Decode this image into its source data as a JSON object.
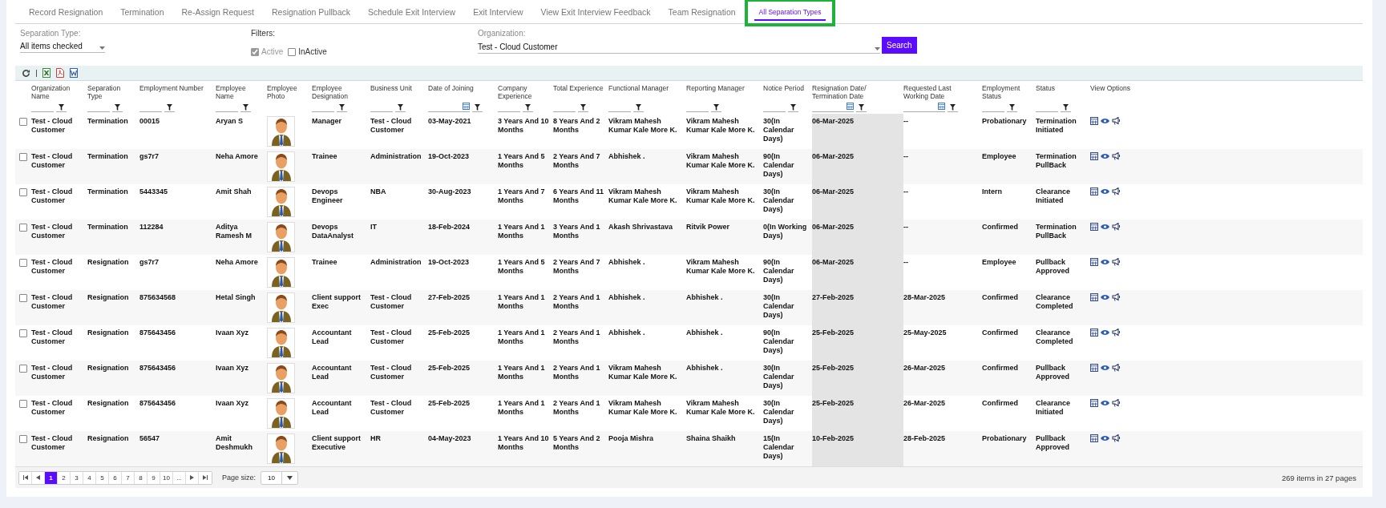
{
  "tabs": [
    {
      "label": "Record Resignation",
      "selected": false,
      "highlighted": false
    },
    {
      "label": "Termination",
      "selected": false,
      "highlighted": false
    },
    {
      "label": "Re-Assign Request",
      "selected": false,
      "highlighted": false
    },
    {
      "label": "Resignation Pullback",
      "selected": false,
      "highlighted": false
    },
    {
      "label": "Schedule Exit Interview",
      "selected": false,
      "highlighted": false
    },
    {
      "label": "Exit Interview",
      "selected": false,
      "highlighted": false
    },
    {
      "label": "View Exit Interview Feedback",
      "selected": false,
      "highlighted": false
    },
    {
      "label": "Team Resignation",
      "selected": false,
      "highlighted": false
    },
    {
      "label": "All Separation Types",
      "selected": true,
      "highlighted": true
    }
  ],
  "filters": {
    "separation_type": {
      "label": "Separation Type:",
      "value": "All items checked"
    },
    "status_filters": {
      "label": "Filters:",
      "options": [
        {
          "label": "Active",
          "checked": true,
          "disabled": true
        },
        {
          "label": "InActive",
          "checked": false,
          "disabled": false
        }
      ]
    },
    "organization": {
      "label": "Organization:",
      "value": "Test - Cloud Customer"
    },
    "search_button": "Search"
  },
  "table": {
    "columns": [
      {
        "label": "Organization Name",
        "kind": "text",
        "filterable": true,
        "date_picker": false,
        "shaded": false
      },
      {
        "label": "Separation Type",
        "kind": "text",
        "filterable": true,
        "date_picker": false,
        "shaded": false
      },
      {
        "label": "Employment Number",
        "kind": "text",
        "filterable": true,
        "date_picker": false,
        "shaded": false
      },
      {
        "label": "Employee Name",
        "kind": "text",
        "filterable": true,
        "date_picker": false,
        "shaded": false
      },
      {
        "label": "Employee Photo",
        "kind": "photo",
        "filterable": false,
        "shaded": false
      },
      {
        "label": "Employee Designation",
        "kind": "text",
        "filterable": true,
        "date_picker": false,
        "shaded": false
      },
      {
        "label": "Business Unit",
        "kind": "text",
        "filterable": true,
        "date_picker": false,
        "shaded": false
      },
      {
        "label": "Date of Joining",
        "kind": "text",
        "filterable": true,
        "date_picker": true,
        "shaded": false
      },
      {
        "label": "Company Experience",
        "kind": "text",
        "filterable": true,
        "date_picker": false,
        "shaded": false
      },
      {
        "label": "Total Experience",
        "kind": "text",
        "filterable": true,
        "date_picker": false,
        "shaded": false
      },
      {
        "label": "Functional Manager",
        "kind": "text",
        "filterable": true,
        "date_picker": false,
        "shaded": false
      },
      {
        "label": "Reporting Manager",
        "kind": "text",
        "filterable": true,
        "date_picker": false,
        "shaded": false
      },
      {
        "label": "Notice Period",
        "kind": "text",
        "filterable": true,
        "date_picker": false,
        "shaded": false
      },
      {
        "label": "Resignation Date/ Termination Date",
        "kind": "text",
        "filterable": true,
        "date_picker": true,
        "shaded": true
      },
      {
        "label": "Requested Last Working Date",
        "kind": "text",
        "filterable": true,
        "date_picker": true,
        "shaded": false
      },
      {
        "label": "Employment Status",
        "kind": "text",
        "filterable": true,
        "date_picker": false,
        "shaded": false
      },
      {
        "label": "Status",
        "kind": "text",
        "filterable": true,
        "date_picker": false,
        "shaded": false
      },
      {
        "label": "View Options",
        "kind": "actions",
        "filterable": false,
        "shaded": false
      }
    ],
    "rows": [
      {
        "checked": false,
        "cells": [
          "Test - Cloud Customer",
          "Termination",
          "00015",
          "Aryan S",
          "",
          "Manager",
          "Test - Cloud Customer",
          "03-May-2021",
          "3 Years And 10 Months",
          "8 Years And 2 Months",
          "Vikram Mahesh Kumar Kale More K.",
          "Vikram Mahesh Kumar Kale More K.",
          "30(In Calendar Days)",
          "06-Mar-2025",
          "--",
          "Probationary",
          "Termination Initiated",
          ""
        ]
      },
      {
        "checked": false,
        "cells": [
          "Test - Cloud Customer",
          "Termination",
          "gs7r7",
          "Neha Amore",
          "",
          "Trainee",
          "Administration",
          "19-Oct-2023",
          "1 Years And 5 Months",
          "2 Years And 7 Months",
          "Abhishek .",
          "Vikram Mahesh Kumar Kale More K.",
          "90(In Calendar Days)",
          "06-Mar-2025",
          "--",
          "Employee",
          "Termination PullBack",
          ""
        ]
      },
      {
        "checked": false,
        "cells": [
          "Test - Cloud Customer",
          "Termination",
          "5443345",
          "Amit Shah",
          "",
          "Devops Engineer",
          "NBA",
          "30-Aug-2023",
          "1 Years And 7 Months",
          "6 Years And 11 Months",
          "Vikram Mahesh Kumar Kale More K.",
          "Vikram Mahesh Kumar Kale More K.",
          "30(In Calendar Days)",
          "06-Mar-2025",
          "--",
          "Intern",
          "Clearance Initiated",
          ""
        ]
      },
      {
        "checked": false,
        "cells": [
          "Test - Cloud Customer",
          "Termination",
          "112284",
          "Aditya Ramesh M",
          "",
          "Devops DataAnalyst",
          "IT",
          "18-Feb-2024",
          "1 Years And 1 Months",
          "3 Years And 1 Months",
          "Akash Shrivastava",
          "Ritvik Power",
          "0(In Working Days)",
          "06-Mar-2025",
          "--",
          "Confirmed",
          "Termination PullBack",
          ""
        ]
      },
      {
        "checked": false,
        "cells": [
          "Test - Cloud Customer",
          "Resignation",
          "gs7r7",
          "Neha Amore",
          "",
          "Trainee",
          "Administration",
          "19-Oct-2023",
          "1 Years And 5 Months",
          "2 Years And 7 Months",
          "Abhishek .",
          "Vikram Mahesh Kumar Kale More K.",
          "90(In Calendar Days)",
          "06-Mar-2025",
          "--",
          "Employee",
          "Pullback Approved",
          ""
        ]
      },
      {
        "checked": false,
        "cells": [
          "Test - Cloud Customer",
          "Resignation",
          "875634568",
          "Hetal Singh",
          "",
          "Client support Exec",
          "Test - Cloud Customer",
          "27-Feb-2025",
          "1 Years And 1 Months",
          "2 Years And 1 Months",
          "Abhishek .",
          "Abhishek .",
          "30(In Calendar Days)",
          "27-Feb-2025",
          "28-Mar-2025",
          "Confirmed",
          "Clearance Completed",
          ""
        ]
      },
      {
        "checked": false,
        "cells": [
          "Test - Cloud Customer",
          "Resignation",
          "875643456",
          "Ivaan Xyz",
          "",
          "Accountant Lead",
          "Test - Cloud Customer",
          "25-Feb-2025",
          "1 Years And 1 Months",
          "2 Years And 1 Months",
          "Abhishek .",
          "Abhishek .",
          "90(In Calendar Days)",
          "25-Feb-2025",
          "25-May-2025",
          "Confirmed",
          "Clearance Completed",
          ""
        ]
      },
      {
        "checked": false,
        "cells": [
          "Test - Cloud Customer",
          "Resignation",
          "875643456",
          "Ivaan Xyz",
          "",
          "Accountant Lead",
          "Test - Cloud Customer",
          "25-Feb-2025",
          "1 Years And 1 Months",
          "2 Years And 1 Months",
          "Vikram Mahesh Kumar Kale More K.",
          "Abhishek .",
          "30(In Calendar Days)",
          "25-Feb-2025",
          "26-Mar-2025",
          "Confirmed",
          "Pullback Approved",
          ""
        ]
      },
      {
        "checked": false,
        "cells": [
          "Test - Cloud Customer",
          "Resignation",
          "875643456",
          "Ivaan Xyz",
          "",
          "Accountant Lead",
          "Test - Cloud Customer",
          "25-Feb-2025",
          "1 Years And 1 Months",
          "2 Years And 1 Months",
          "Vikram Mahesh Kumar Kale More K.",
          "Vikram Mahesh Kumar Kale More K.",
          "30(In Calendar Days)",
          "25-Feb-2025",
          "26-Mar-2025",
          "Confirmed",
          "Clearance Initiated",
          ""
        ]
      },
      {
        "checked": false,
        "cells": [
          "Test - Cloud Customer",
          "Resignation",
          "56547",
          "Amit Deshmukh",
          "",
          "Client support Executive",
          "HR",
          "04-May-2023",
          "1 Years And 10 Months",
          "5 Years And 2 Months",
          "Pooja Mishra",
          "Shaina Shaikh",
          "15(In Calendar Days)",
          "10-Feb-2025",
          "28-Feb-2025",
          "Probationary",
          "Pullback Approved",
          ""
        ]
      }
    ]
  },
  "pager": {
    "pages": [
      {
        "label": "1",
        "selected": true
      },
      {
        "label": "2",
        "selected": false
      },
      {
        "label": "3",
        "selected": false
      },
      {
        "label": "4",
        "selected": false
      },
      {
        "label": "5",
        "selected": false
      },
      {
        "label": "6",
        "selected": false
      },
      {
        "label": "7",
        "selected": false
      },
      {
        "label": "8",
        "selected": false
      },
      {
        "label": "9",
        "selected": false
      },
      {
        "label": "10",
        "selected": false
      },
      {
        "label": "...",
        "selected": false
      }
    ],
    "page_size_label": "Page size:",
    "page_size": "10",
    "info": "269 items in 27 pages"
  }
}
